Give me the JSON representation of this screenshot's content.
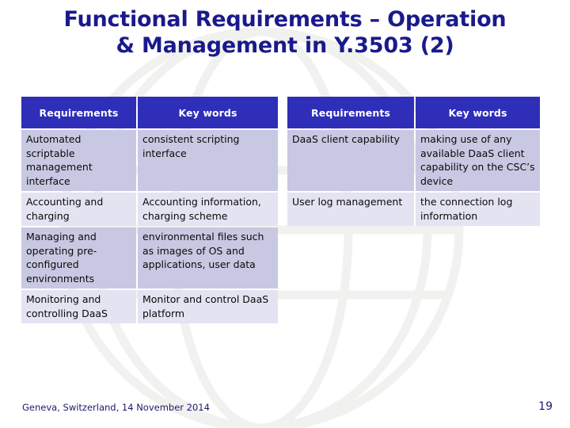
{
  "slide": {
    "title_line1": "Functional Requirements – Operation",
    "title_line2": "& Management in Y.3503 (2)",
    "title_color": "#1a1a8c"
  },
  "colors": {
    "header_blue": "#2e2eb8",
    "row_shade": "#c8c8e2",
    "row_light": "#e3e3f2",
    "text_dark": "#0a0a0a",
    "footer_navy": "#1a1a6e",
    "background": "#ffffff"
  },
  "tables": {
    "left": {
      "name": "requirements-table-left",
      "headers": [
        "Requirements",
        "Key words"
      ],
      "rows": [
        {
          "requirement": "Automated scriptable management interface",
          "keywords": "consistent scripting interface",
          "shaded": true
        },
        {
          "requirement": "Accounting and charging",
          "keywords": "Accounting information, charging scheme",
          "shaded": false
        },
        {
          "requirement": "Managing and operating pre-configured environments",
          "keywords": "environmental files such as images of OS and applications, user data",
          "shaded": true
        },
        {
          "requirement": "Monitoring and controlling DaaS",
          "keywords": "Monitor and control DaaS platform",
          "shaded": false
        }
      ]
    },
    "right": {
      "name": "requirements-table-right",
      "headers": [
        "Requirements",
        "Key words"
      ],
      "rows": [
        {
          "requirement": "DaaS client capability",
          "keywords": "making use of any available DaaS client capability on the CSC’s device",
          "shaded": true
        },
        {
          "requirement": "User log management",
          "keywords": "the connection log information",
          "shaded": false
        }
      ]
    }
  },
  "footer": {
    "note": "Geneva, Switzerland, 14 November 2014",
    "page_number": "19"
  }
}
